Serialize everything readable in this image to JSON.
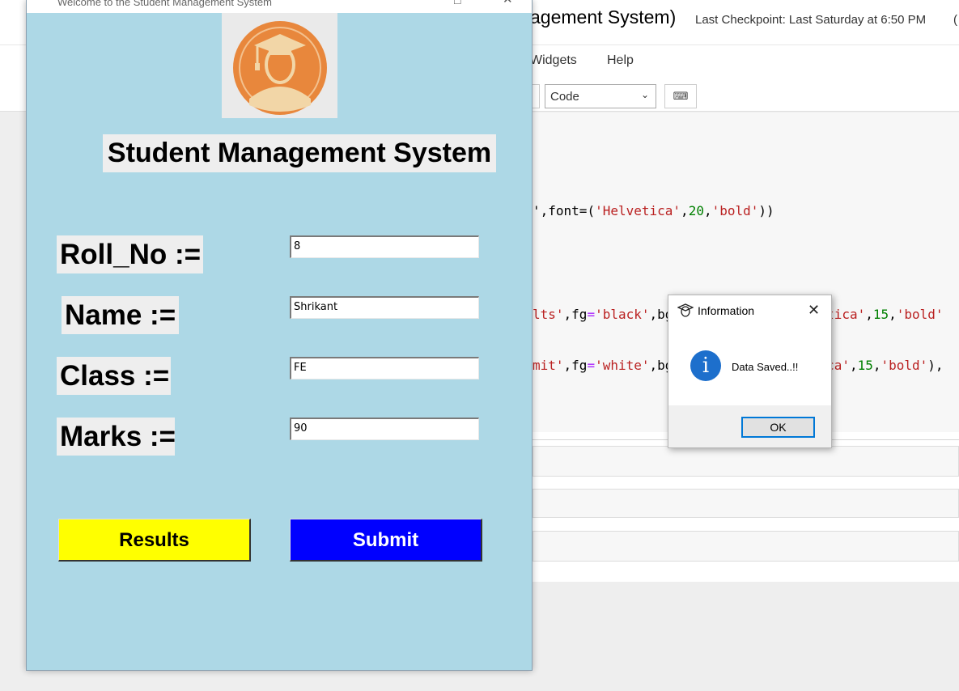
{
  "notebook": {
    "title_partial": "agement System)",
    "checkpoint": "Last Checkpoint: Last Saturday at 6:50 PM",
    "extra": "(",
    "menu": [
      {
        "label": "Widgets"
      },
      {
        "label": "Help"
      }
    ],
    "cell_type": "Code",
    "keyboard_icon": "keyboard-icon",
    "code_lines": {
      "line1_a": ",font=(",
      "line1_b": "'Helvetica'",
      "line1_c": ",",
      "line1_d": "20",
      "line1_e": ",",
      "line1_f": "'bold'",
      "line1_g": "))",
      "line0_a": "'",
      "line2_a": "lts'",
      "line2_b": ",fg",
      "line2_c": "=",
      "line2_d": "'black'",
      "line2_e": ",bg",
      "line2_f": "etica'",
      "line2_g": ",",
      "line2_h": "15",
      "line2_i": ",",
      "line2_j": "'bold'",
      "line3_a": "mit'",
      "line3_b": ",fg",
      "line3_c": "=",
      "line3_d": "'white'",
      "line3_e": ",bg",
      "line3_f": "ica'",
      "line3_g": ",",
      "line3_h": "15",
      "line3_i": ",",
      "line3_j": "'bold'",
      "line3_k": "),"
    }
  },
  "tk_window": {
    "title": "Welcome to the Student Management System",
    "app_title": "Student Management System",
    "fields": [
      {
        "label": "Roll_No :=",
        "value": "8"
      },
      {
        "label": "Name :=",
        "value": "Shrikant"
      },
      {
        "label": "Class :=",
        "value": "FE"
      },
      {
        "label": "Marks :=",
        "value": "90"
      }
    ],
    "results_label": "Results",
    "submit_label": "Submit",
    "colors": {
      "background": "#add8e6",
      "results_bg": "#ffff00",
      "submit_bg": "#0000ff"
    }
  },
  "messagebox": {
    "title": "Information",
    "message": "Data Saved..!!",
    "ok_label": "OK",
    "icon": "info-icon"
  }
}
